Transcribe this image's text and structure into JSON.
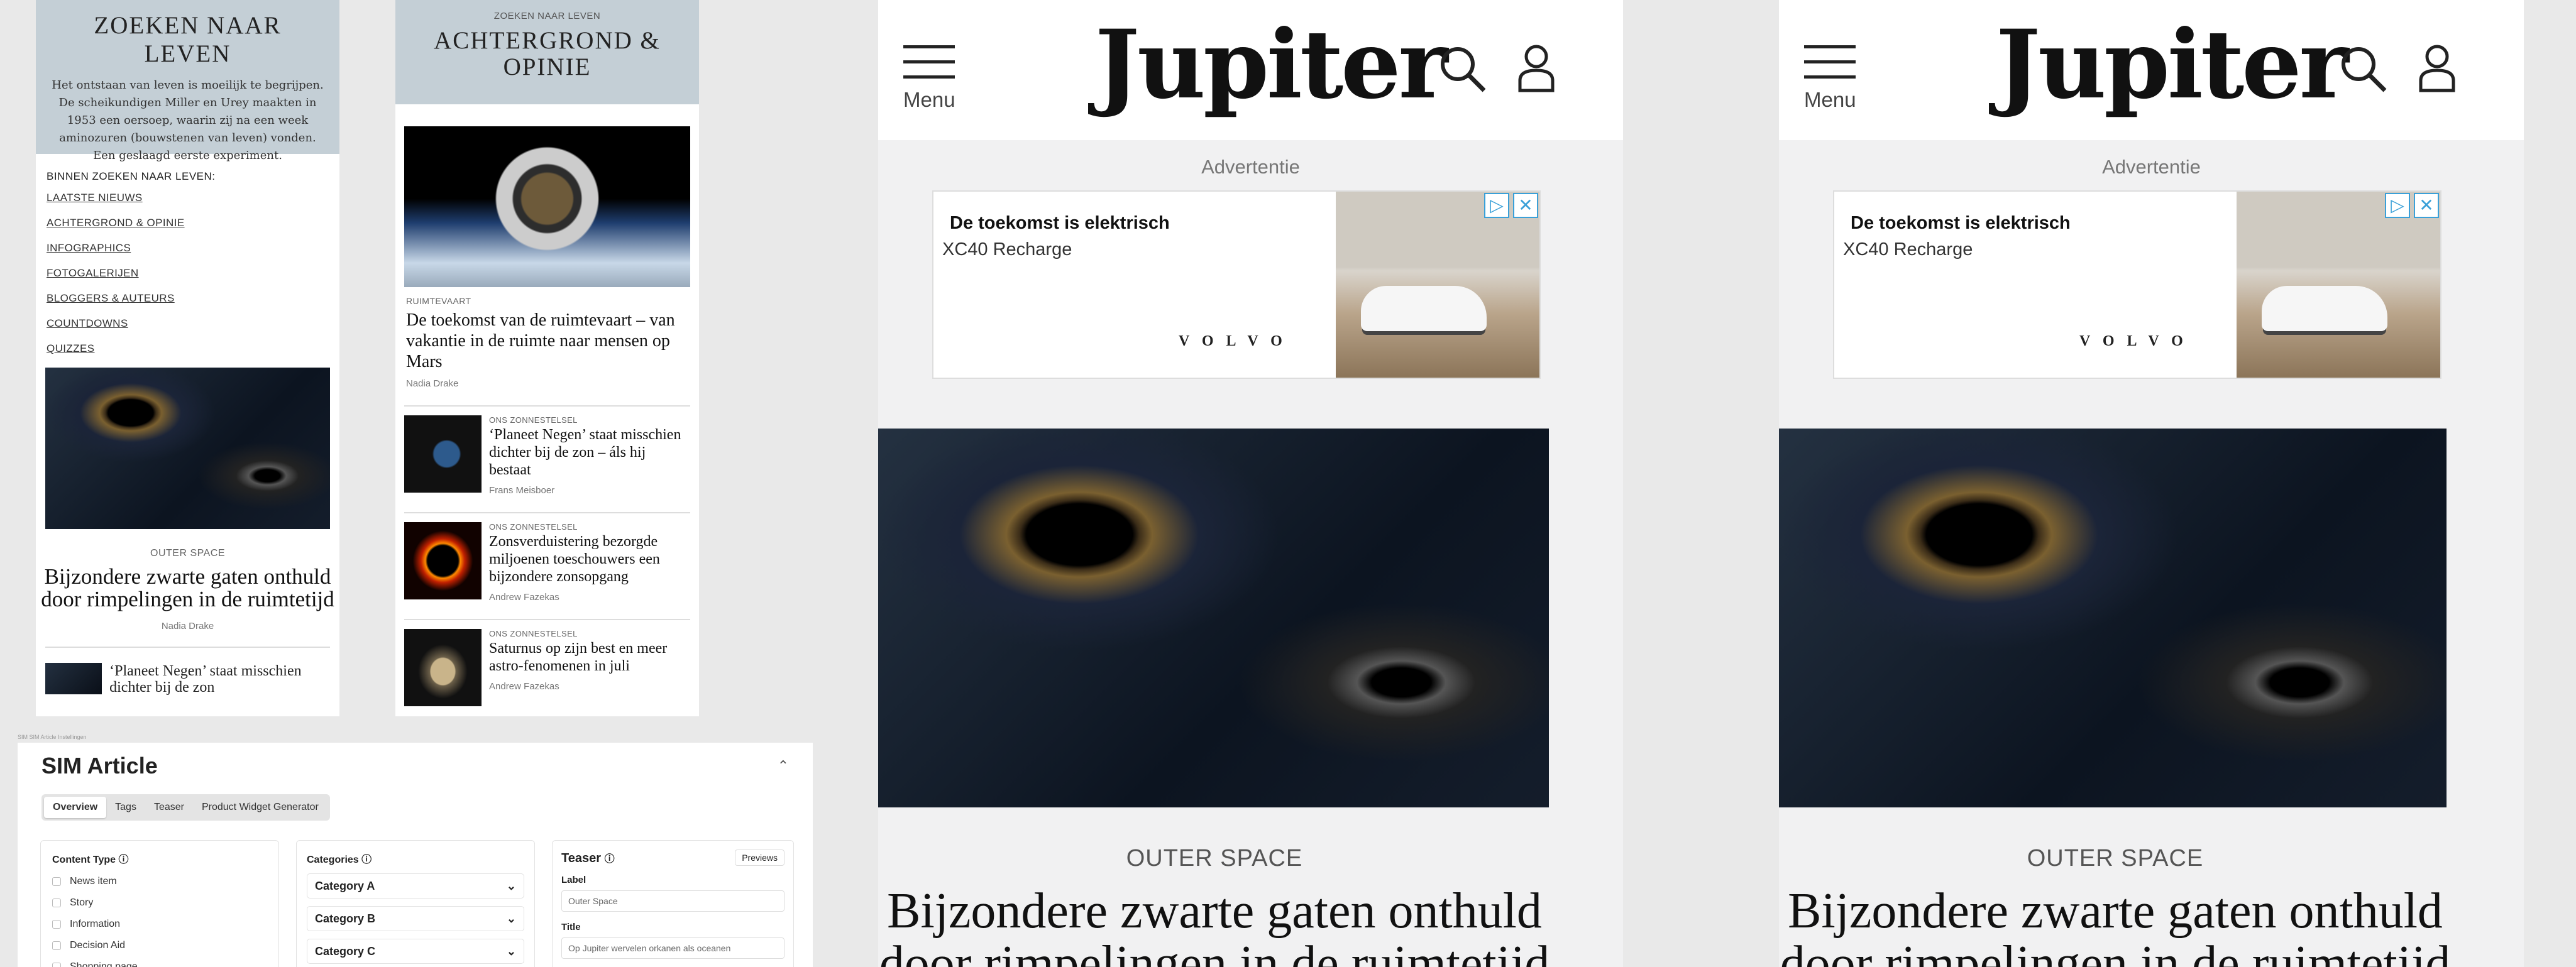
{
  "panel_left": {
    "title": "ZOEKEN NAAR LEVEN",
    "intro": "Het ontstaan van leven is moeilijk te begrijpen. De scheikundigen Miller en Urey maakten in 1953 een oersoep, waarin zij na een week aminozuren (bouwstenen van leven) vonden. Een geslaagd eerste experiment.",
    "nav_title": "BINNEN ZOEKEN NAAR LEVEN:",
    "nav": [
      "LAATSTE NIEUWS",
      "ACHTERGROND & OPINIE",
      "INFOGRAPHICS",
      "FOTOGALERIJEN",
      "BLOGGERS & AUTEURS",
      "COUNTDOWNS",
      "QUIZZES"
    ],
    "featured": {
      "kicker": "OUTER SPACE",
      "title": "Bijzondere zwarte gaten onthuld door rimpelingen in de ruimtetijd",
      "author": "Nadia Drake"
    },
    "next_title": "‘Planeet Negen’ staat misschien dichter bij de zon"
  },
  "panel_mid": {
    "kicker": "ZOEKEN NAAR LEVEN",
    "title": "ACHTERGROND & OPINIE",
    "hero": {
      "kicker": "RUIMTEVAART",
      "title": "De toekomst van de ruimtevaart – van vakantie in de ruimte naar mensen op Mars",
      "author": "Nadia Drake"
    },
    "items": [
      {
        "kicker": "ONS ZONNESTELSEL",
        "title": "‘Planeet Negen’ staat misschien dichter bij de zon – áls hij bestaat",
        "author": "Frans Meisboer",
        "thumb": "planet"
      },
      {
        "kicker": "ONS ZONNESTELSEL",
        "title": "Zonsverduistering bezorgde miljoenen toeschouwers een bijzondere zonsopgang",
        "author": "Andrew Fazekas",
        "thumb": "eclipse"
      },
      {
        "kicker": "ONS ZONNESTELSEL",
        "title": "Saturnus op zijn best en meer astro-fenomenen in juli",
        "author": "Andrew Fazekas",
        "thumb": "saturn"
      }
    ]
  },
  "sim": {
    "crumb": "SIM SIM Article Instellingen",
    "title": "SIM Article",
    "tabs": [
      "Overview",
      "Tags",
      "Teaser",
      "Product Widget Generator"
    ],
    "content_type": {
      "label": "Content Type",
      "options": [
        "News item",
        "Story",
        "Information",
        "Decision Aid",
        "Shopping page"
      ]
    },
    "categories": {
      "label": "Categories",
      "items": [
        "Category A",
        "Category B",
        "Category C"
      ]
    },
    "teaser": {
      "label": "Teaser",
      "previews": "Previews",
      "field_label": "Label",
      "field_value": "Outer Space",
      "title_label": "Title",
      "title_value": "Op Jupiter wervelen orkanen als oceanen"
    }
  },
  "phone": {
    "menu": "Menu",
    "logo": "Jupiter",
    "ad_label": "Advertentie",
    "ad_title": "De toekomst is elektrisch",
    "ad_sub": "XC40 Recharge",
    "ad_brand": "VOLVO",
    "ad_play": "▷",
    "ad_close": "✕",
    "kicker": "OUTER SPACE",
    "title": "Bijzondere zwarte gaten onthuld door rimpelingen in de ruimtetijd"
  }
}
